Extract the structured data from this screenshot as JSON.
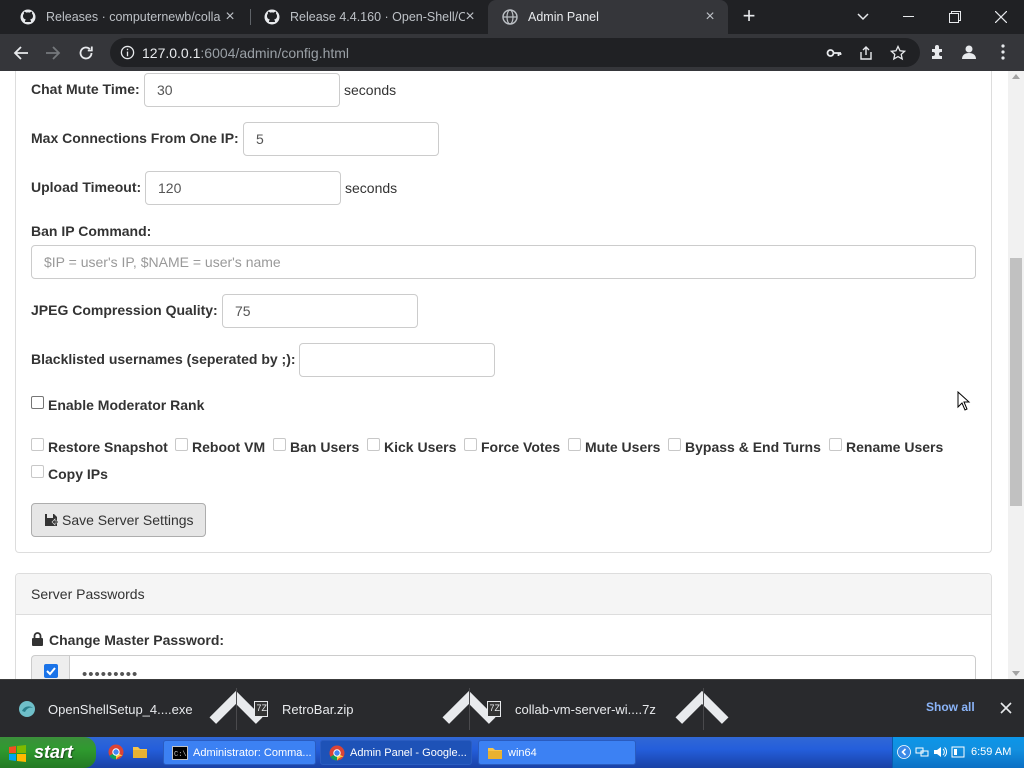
{
  "tabs": [
    {
      "title": "Releases · computernewb/collab-",
      "icon": "github-icon"
    },
    {
      "title": "Release 4.4.160 · Open-Shell/Ope",
      "icon": "github-icon"
    },
    {
      "title": "Admin Panel",
      "icon": "globe-icon",
      "active": true
    }
  ],
  "address": {
    "host": "127.0.0.1",
    "rest": ":6004/admin/config.html"
  },
  "form": {
    "chat_mute_label": "Chat Mute Time:",
    "chat_mute_value": "30",
    "chat_mute_unit": "seconds",
    "max_conn_label": "Max Connections From One IP:",
    "max_conn_value": "5",
    "upload_label": "Upload Timeout:",
    "upload_value": "120",
    "upload_unit": "seconds",
    "ban_label": "Ban IP Command:",
    "ban_placeholder": "$IP = user's IP, $NAME = user's name",
    "jpeg_label": "JPEG Compression Quality:",
    "jpeg_value": "75",
    "blacklist_label": "Blacklisted usernames (seperated by ;):",
    "blacklist_value": "",
    "mod_rank_label": "Enable Moderator Rank",
    "permissions": [
      "Restore Snapshot",
      "Reboot VM",
      "Ban Users",
      "Kick Users",
      "Force Votes",
      "Mute Users",
      "Bypass & End Turns",
      "Rename Users",
      "Copy IPs"
    ],
    "save_label": "Save Server Settings"
  },
  "passwords": {
    "heading": "Server Passwords",
    "master_label": "Change Master Password:",
    "master_value": "•••••••••"
  },
  "downloads": {
    "items": [
      "OpenShellSetup_4....exe",
      "RetroBar.zip",
      "collab-vm-server-wi....7z"
    ],
    "show_all": "Show all"
  },
  "taskbar": {
    "start": "start",
    "tasks": [
      "Administrator: Comma...",
      "Admin Panel - Google...",
      "win64"
    ],
    "clock": "6:59 AM"
  }
}
